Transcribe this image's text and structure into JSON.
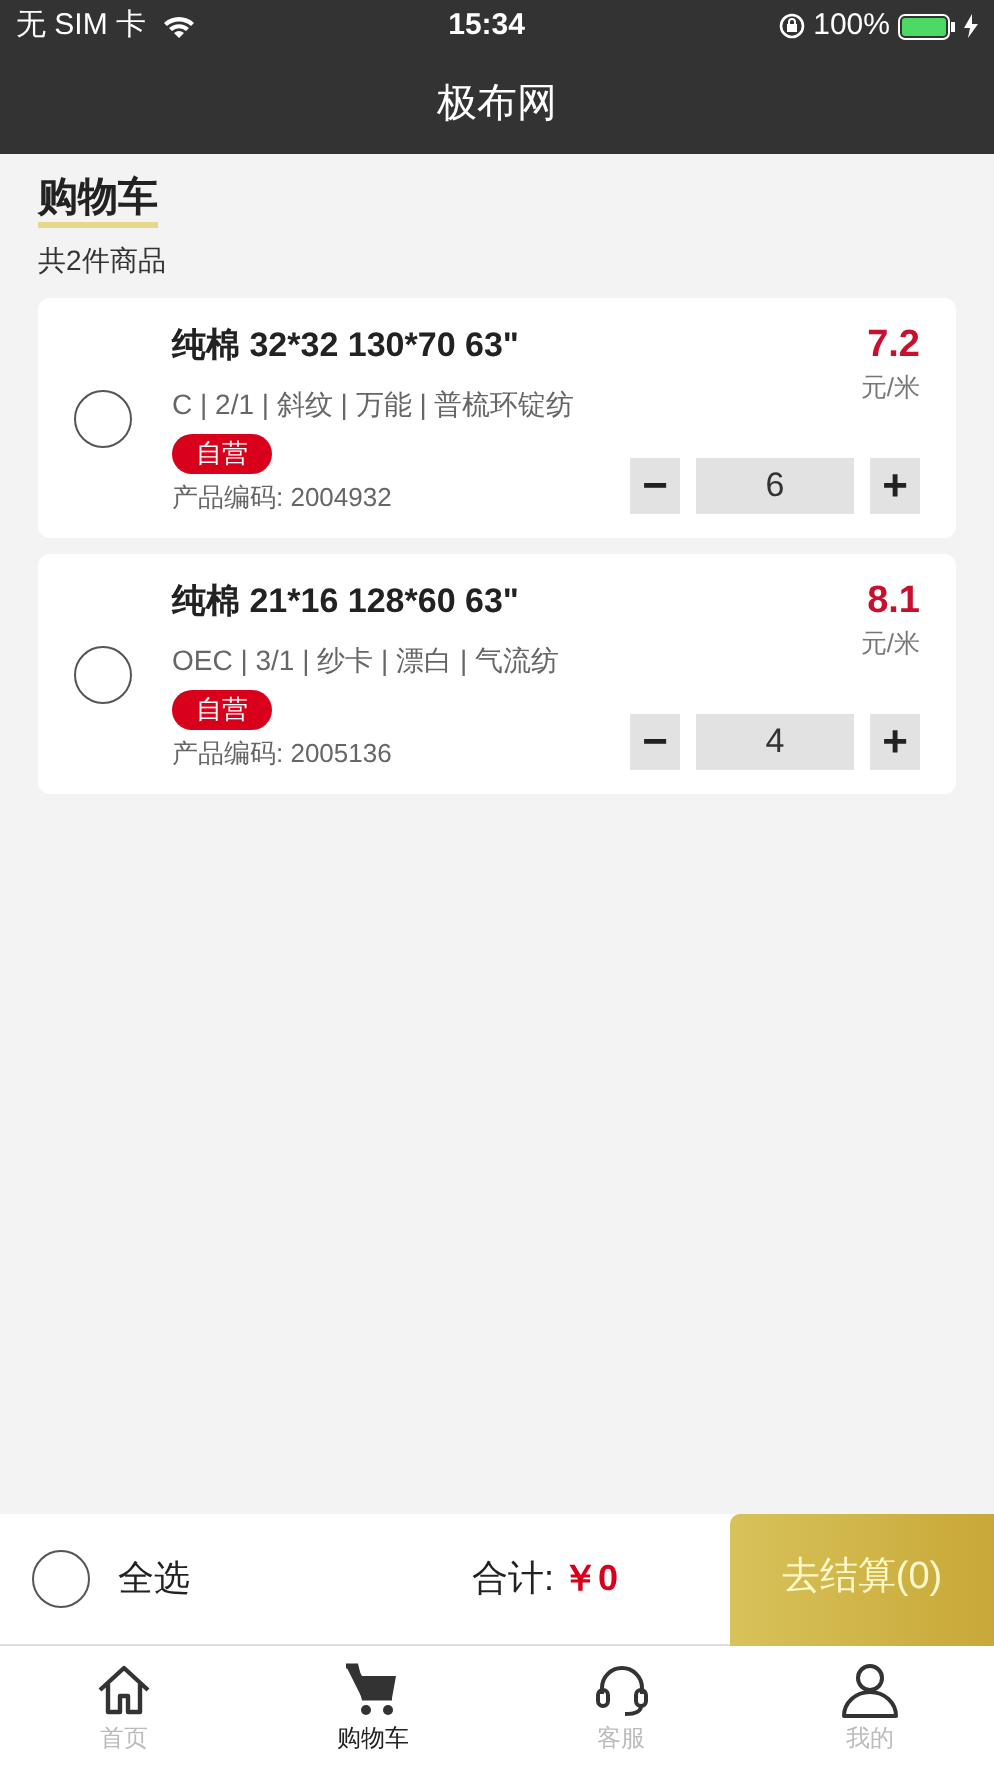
{
  "status_bar": {
    "carrier": "无 SIM 卡",
    "time": "15:34",
    "battery": "100%"
  },
  "nav": {
    "title": "极布网"
  },
  "cart": {
    "title": "购物车",
    "count": "共2件商品"
  },
  "items": [
    {
      "name": "纯棉 32*32 130*70 63\"",
      "specs": "C | 2/1 | 斜纹 | 万能 | 普梳环锭纺",
      "tag": "自营",
      "code": "产品编码: 2004932",
      "price": "7.2",
      "unit": "元/米",
      "minus": "−",
      "quantity": "6",
      "plus": "+",
      "selected": false
    },
    {
      "name": "纯棉 21*16 128*60 63\"",
      "specs": "OEC | 3/1 | 纱卡 | 漂白 | 气流纺",
      "tag": "自营",
      "code": "产品编码: 2005136",
      "price": "8.1",
      "unit": "元/米",
      "minus": "−",
      "quantity": "4",
      "plus": "+",
      "selected": false
    }
  ],
  "footer": {
    "select_all": {
      "label": "全选",
      "checked": false
    },
    "total_label": "合计:",
    "total": "￥0",
    "checkout": "去结算(0)"
  },
  "tabs": [
    {
      "label": "首页",
      "kind": "home",
      "selected": false
    },
    {
      "label": "购物车",
      "kind": "cart",
      "selected": true
    },
    {
      "label": "客服",
      "kind": "headset",
      "selected": false
    },
    {
      "label": "我的",
      "kind": "user",
      "selected": false
    }
  ]
}
